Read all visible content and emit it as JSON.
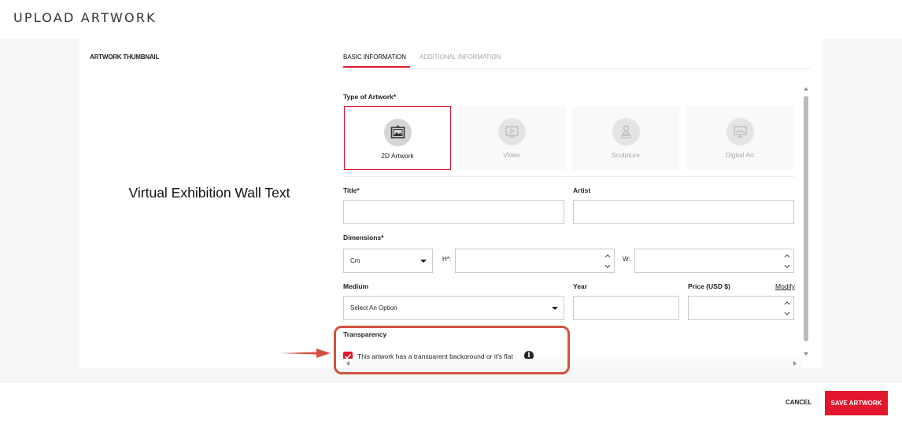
{
  "header": {
    "title": "UPLOAD ARTWORK"
  },
  "thumbnail": {
    "label": "ARTWORK THUMBNAIL",
    "placeholder_text": "Virtual Exhibition Wall Text"
  },
  "tabs": [
    {
      "label": "BASIC INFORMATION",
      "active": true
    },
    {
      "label": "ADDITIONAL INFORMATION",
      "active": false
    }
  ],
  "form": {
    "type_label": "Type of Artwork*",
    "types": [
      {
        "label": "2D Artwork",
        "icon": "frame-icon",
        "selected": true
      },
      {
        "label": "Video",
        "icon": "video-icon",
        "selected": false
      },
      {
        "label": "Sculpture",
        "icon": "sculpture-icon",
        "selected": false
      },
      {
        "label": "Digital Art",
        "icon": "digital-art-icon",
        "selected": false
      }
    ],
    "title_label": "Title*",
    "title_value": "",
    "artist_label": "Artist",
    "artist_value": "",
    "dimensions_label": "Dimensions*",
    "unit_value": "Cm",
    "height_label": "H*:",
    "height_value": "",
    "width_label": "W:",
    "width_value": "",
    "medium_label": "Medium",
    "medium_value": "Select An Option",
    "year_label": "Year",
    "year_value": "",
    "price_label": "Price (USD $)",
    "price_value": "",
    "modify_label": "Modify",
    "transparency_label": "Transparency",
    "transparency_checkbox_label": "This artwork has a transparent background or it's flat",
    "transparency_checked": true,
    "info_icon_glyph": "i"
  },
  "footer": {
    "cancel_label": "CANCEL",
    "save_label": "SAVE ARTWORK"
  },
  "colors": {
    "accent": "#e2162c",
    "annotation": "#d0533f"
  }
}
